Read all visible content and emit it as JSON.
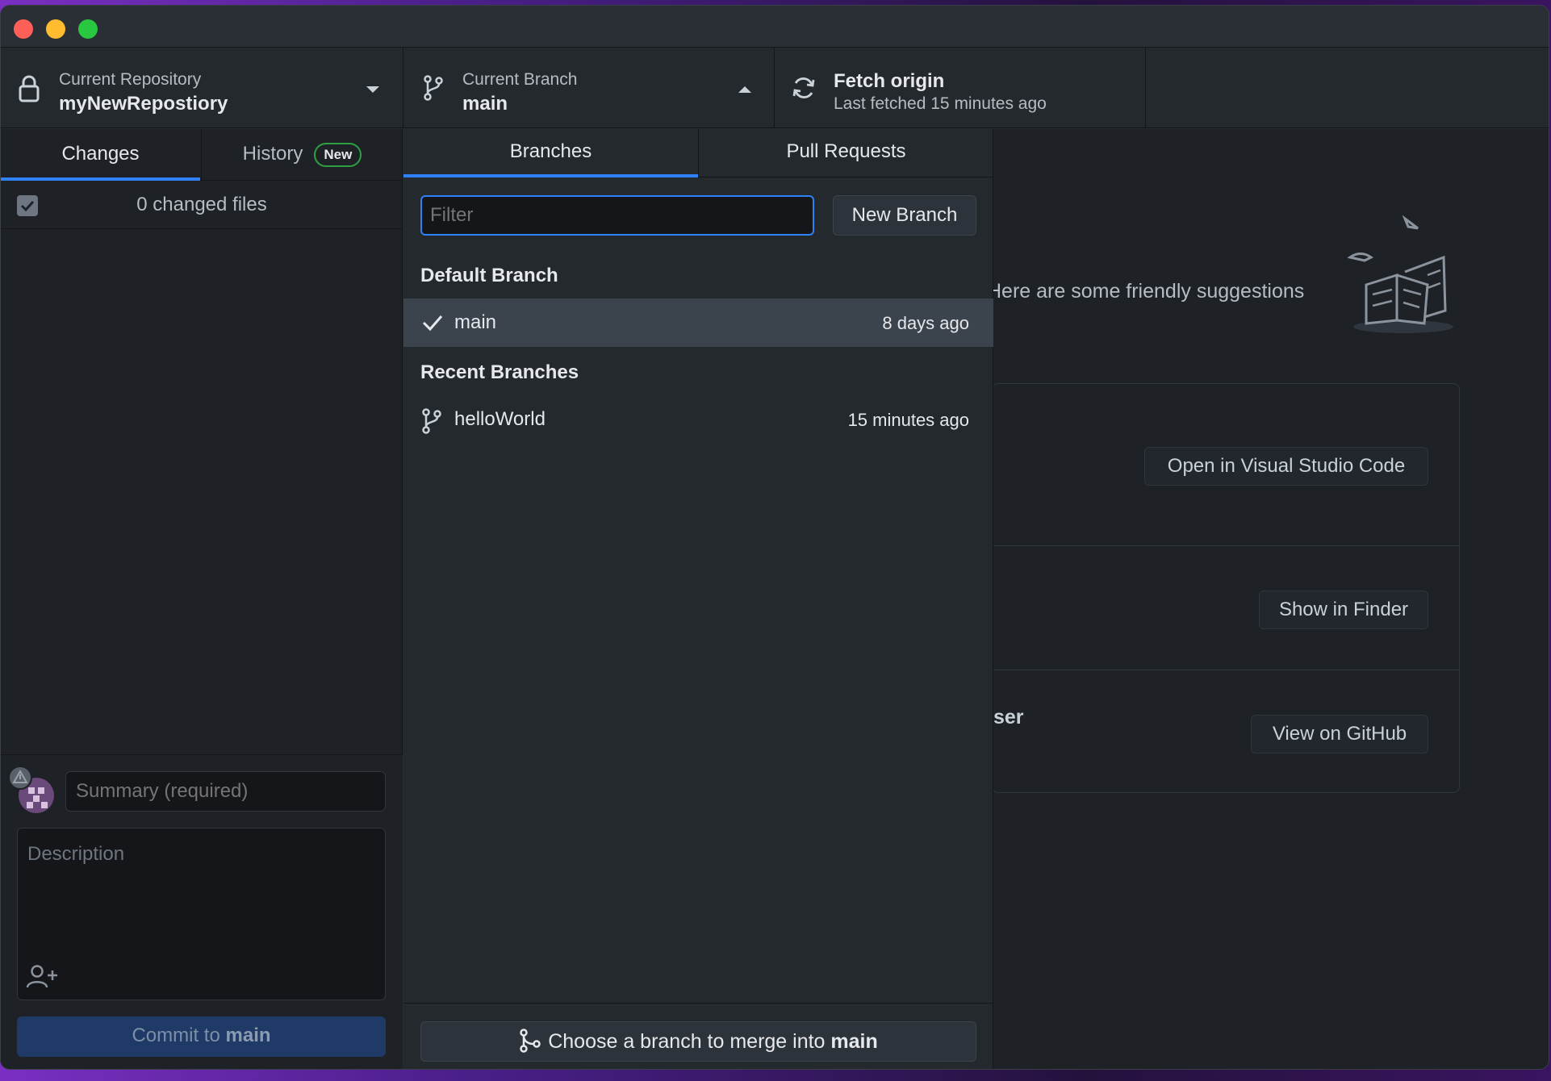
{
  "toolbar": {
    "repo": {
      "title": "Current Repository",
      "value": "myNewRepostiory"
    },
    "branch": {
      "title": "Current Branch",
      "value": "main"
    },
    "fetch": {
      "title": "Fetch origin",
      "subtitle": "Last fetched 15 minutes ago"
    }
  },
  "sidebar": {
    "tabs": [
      {
        "label": "Changes"
      },
      {
        "label": "History",
        "badge": "New"
      }
    ],
    "changed_files": "0 changed files",
    "commit": {
      "summary_placeholder": "Summary (required)",
      "description_placeholder": "Description",
      "button_prefix": "Commit to",
      "button_branch": "main"
    }
  },
  "main": {
    "suggestions_text": "Here are some friendly suggestions",
    "row3_label_fragment": "ser",
    "buttons": {
      "open_editor": "Open in Visual Studio Code",
      "show_finder": "Show in Finder",
      "view_github": "View on GitHub"
    }
  },
  "branch_dropdown": {
    "tabs": [
      {
        "label": "Branches"
      },
      {
        "label": "Pull Requests"
      }
    ],
    "filter_placeholder": "Filter",
    "new_branch_label": "New Branch",
    "sections": {
      "default": "Default Branch",
      "recent": "Recent Branches"
    },
    "default_branch": {
      "name": "main",
      "time": "8 days ago"
    },
    "recent_branches": [
      {
        "name": "helloWorld",
        "time": "15 minutes ago"
      }
    ],
    "merge": {
      "prefix": "Choose a branch to merge into",
      "branch": "main"
    }
  },
  "colors": {
    "accent": "#2f81f7",
    "badge_border": "#2ea043",
    "background": "#24292e"
  }
}
